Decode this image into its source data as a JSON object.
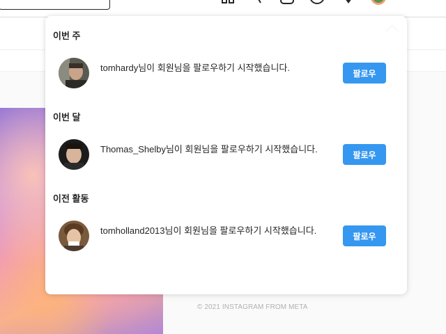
{
  "footer": {
    "copyright": "© 2021 INSTAGRAM FROM META"
  },
  "notifications": {
    "sections": [
      {
        "title": "이번 주",
        "items": [
          {
            "username": "tomhardy",
            "message": "님이 회원님을 팔로우하기 시작했습니다.",
            "button_label": "팔로우"
          }
        ]
      },
      {
        "title": "이번 달",
        "items": [
          {
            "username": "Thomas_Shelby",
            "message": "님이 회원님을 팔로우하기 시작했습니다.",
            "button_label": "팔로우"
          }
        ]
      },
      {
        "title": "이전 활동",
        "items": [
          {
            "username": "tomholland2013",
            "message": "님이 회원님을 팔로우하기 시작했습니다.",
            "button_label": "팔로우"
          }
        ]
      }
    ]
  },
  "colors": {
    "accent": "#3597f0",
    "text": "#262626",
    "muted": "#b0b0b0"
  },
  "icons": [
    "search-box",
    "reels-icon",
    "direct-icon",
    "new-post-icon",
    "explore-icon",
    "heart-icon",
    "profile-avatar"
  ]
}
